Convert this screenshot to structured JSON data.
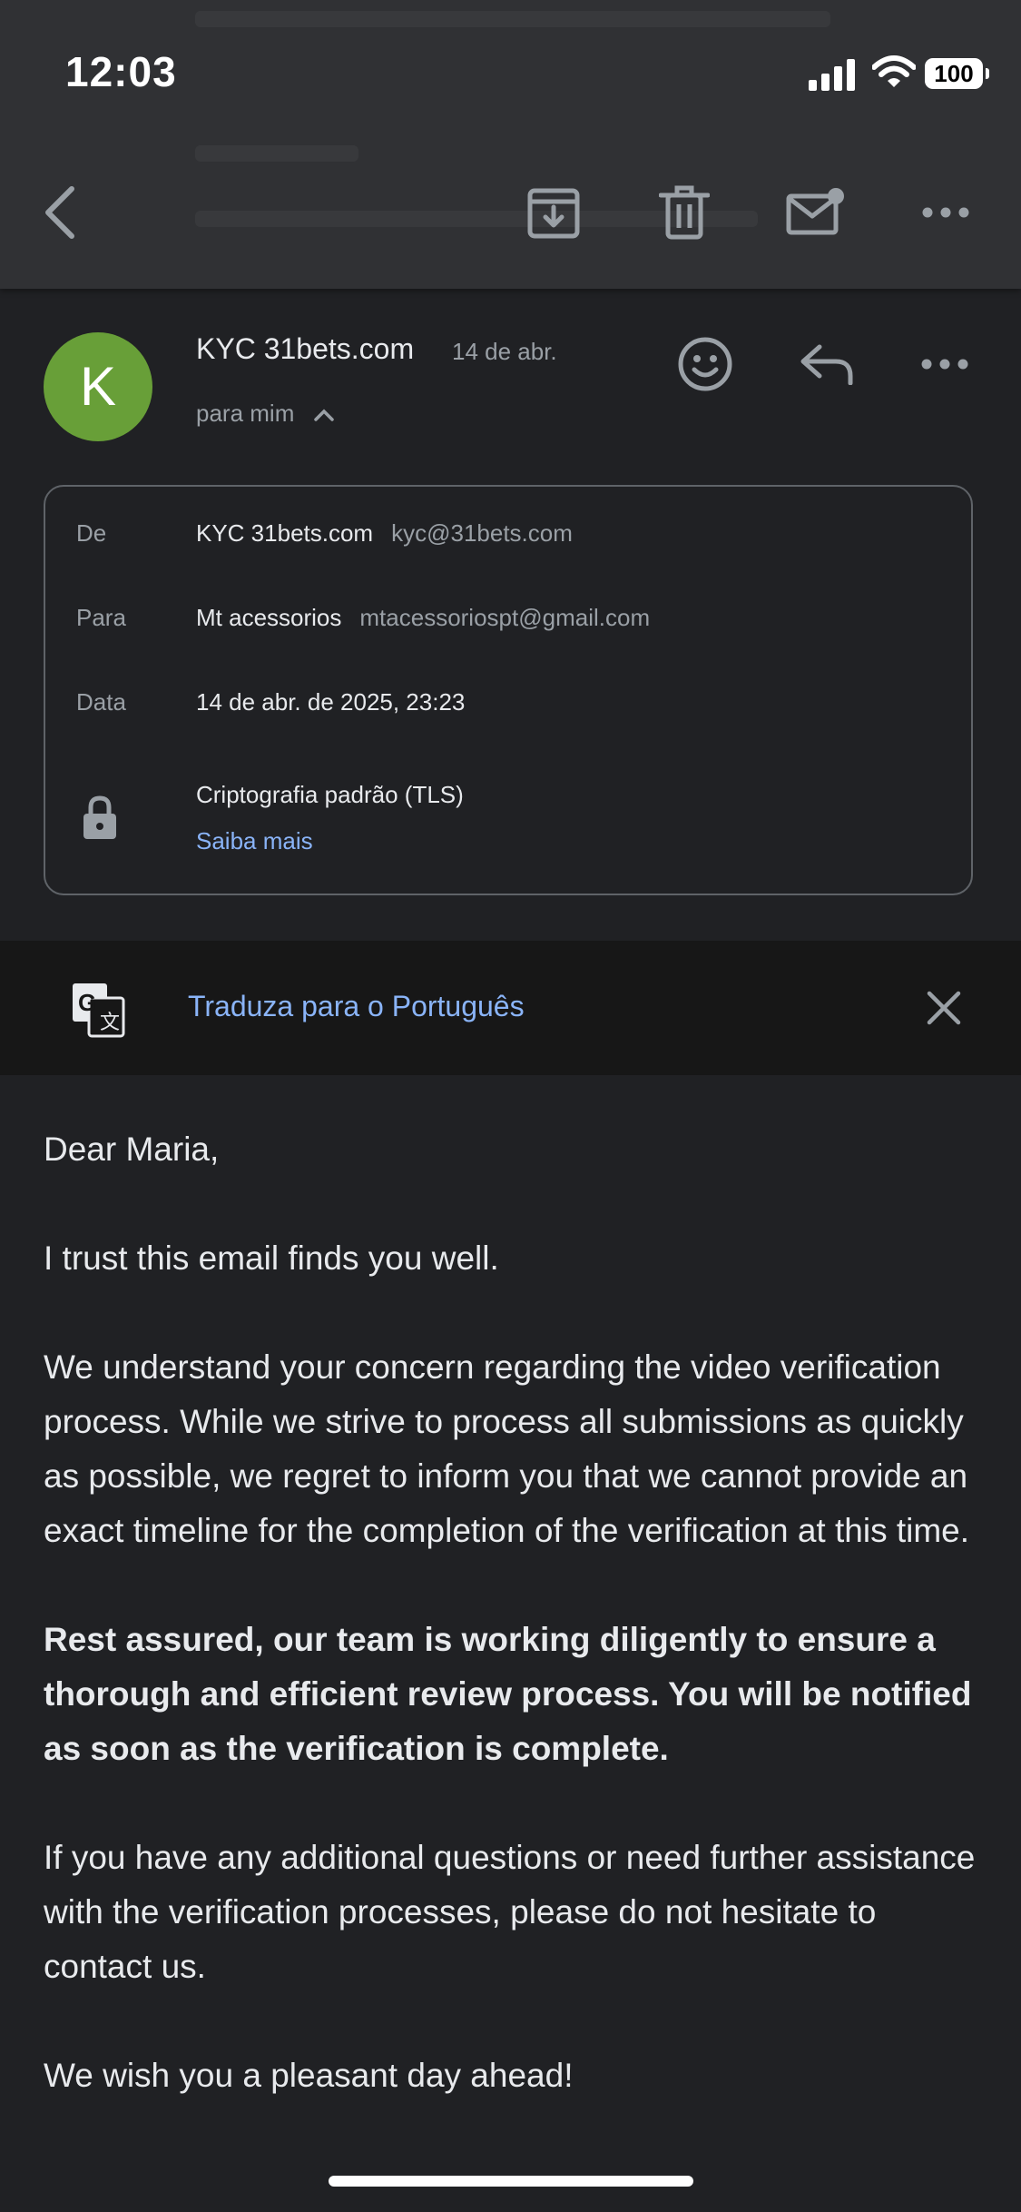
{
  "status_bar": {
    "time": "12:03",
    "battery": "100"
  },
  "toolbar": {
    "back": "back",
    "archive": "archive",
    "delete": "delete",
    "mark_unread": "mark-unread",
    "more": "more"
  },
  "header": {
    "avatar_letter": "K",
    "sender_name": "KYC 31bets.com",
    "date": "14 de abr.",
    "recipient": "para mim"
  },
  "details": {
    "from_label": "De",
    "from_name": "KYC 31bets.com",
    "from_email": "kyc@31bets.com",
    "to_label": "Para",
    "to_name": "Mt acessorios",
    "to_email": "mtacessoriospt@gmail.com",
    "date_label": "Data",
    "date_value": "14 de abr. de 2025, 23:23",
    "security": "Criptografia padrão (TLS)",
    "learn_more": "Saiba mais"
  },
  "translate": {
    "label": "Traduza para o Português"
  },
  "body": {
    "greeting": "Dear Maria,",
    "p1": "I trust this email finds you well.",
    "p2": "We understand your concern regarding the video verification process. While we strive to process all submissions as quickly as possible, we regret to inform you that we cannot provide an exact timeline for the completion of the verification at this time.",
    "p3": "Rest assured, our team is working diligently to ensure a thorough and efficient review process. You will be notified as soon as the verification is complete.",
    "p4": "If you have any additional questions or need further assistance with the verification processes, please do not hesitate to contact us.",
    "p5": "We wish you a pleasant day ahead!"
  },
  "colors": {
    "background": "#202124",
    "toolbar": "#303134",
    "avatar": "#689f38",
    "link": "#8ab4f8"
  }
}
